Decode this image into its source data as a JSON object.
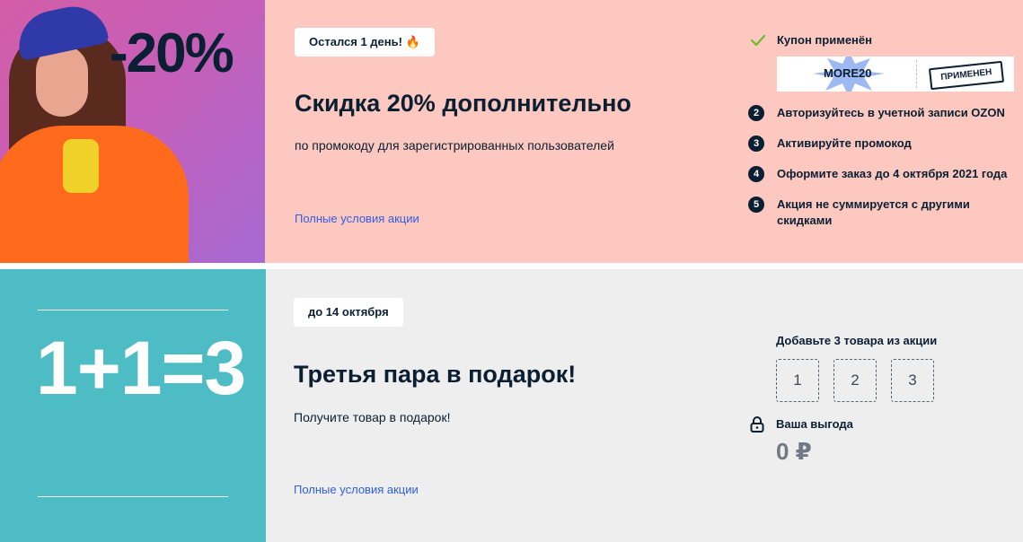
{
  "promo1": {
    "image_text": "-20%",
    "badge": "Остался 1 день! 🔥",
    "title": "Скидка 20% дополнительно",
    "subtitle": "по промокоду для зарегистрированных пользователей",
    "link": "Полные условия акции",
    "coupon_status": "Купон применён",
    "coupon_code": "MORE20",
    "coupon_stamp": "ПРИМЕНЕН",
    "steps": [
      {
        "num": "2",
        "label": "Авторизуйтесь в учетной записи OZON"
      },
      {
        "num": "3",
        "label": "Активируйте промокод"
      },
      {
        "num": "4",
        "label": "Оформите заказ до 4 октября 2021 года"
      },
      {
        "num": "5",
        "label": "Акция не суммируется с другими скидками"
      }
    ]
  },
  "promo2": {
    "image_text": "1+1=3",
    "badge": "до 14 октября",
    "title": "Третья пара в подарок!",
    "subtitle": "Получите товар в подарок!",
    "link": "Полные условия акции",
    "add_label": "Добавьте 3 товара из акции",
    "slots": [
      "1",
      "2",
      "3"
    ],
    "benefit_label": "Ваша выгода",
    "benefit_value": "0 ₽"
  },
  "colors": {
    "promo1_bg": "#fcc8c0",
    "promo2_bg": "#eeeeee",
    "teal": "#4ebcc4",
    "text_dark": "#0b1f33",
    "link_blue": "#2f5fe0",
    "check_green": "#6dbb2a"
  }
}
